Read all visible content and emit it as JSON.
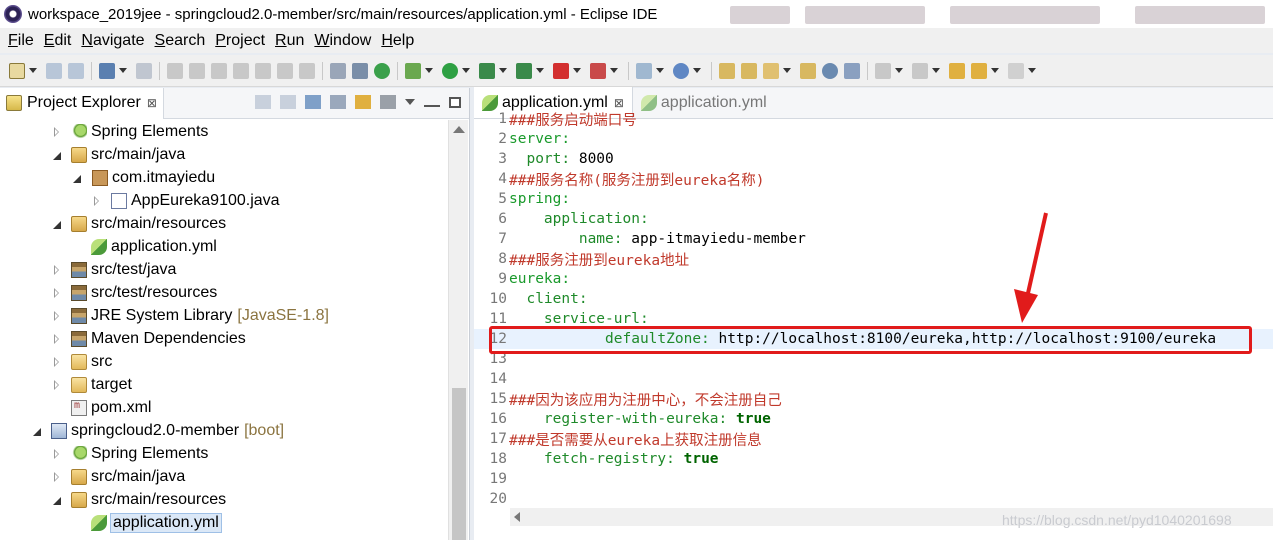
{
  "window": {
    "title": "workspace_2019jee - springcloud2.0-member/src/main/resources/application.yml - Eclipse IDE"
  },
  "menu": {
    "items": [
      {
        "label": "File",
        "key": "F",
        "rest": "ile"
      },
      {
        "label": "Edit",
        "key": "E",
        "rest": "dit"
      },
      {
        "label": "Navigate",
        "key": "N",
        "rest": "avigate"
      },
      {
        "label": "Search",
        "key": "S",
        "rest": "earch"
      },
      {
        "label": "Project",
        "key": "P",
        "rest": "roject"
      },
      {
        "label": "Run",
        "key": "R",
        "rest": "un"
      },
      {
        "label": "Window",
        "key": "W",
        "rest": "indow"
      },
      {
        "label": "Help",
        "key": "H",
        "rest": "elp"
      }
    ]
  },
  "explorer": {
    "tab_label": "Project Explorer",
    "close_glyph": "⊠",
    "tree": [
      {
        "label": "Spring Elements",
        "decoration": ""
      },
      {
        "label": "src/main/java",
        "decoration": ""
      },
      {
        "label": "com.itmayiedu",
        "decoration": ""
      },
      {
        "label": "AppEureka9100.java",
        "decoration": ""
      },
      {
        "label": "src/main/resources",
        "decoration": ""
      },
      {
        "label": "application.yml",
        "decoration": ""
      },
      {
        "label": "src/test/java",
        "decoration": ""
      },
      {
        "label": "src/test/resources",
        "decoration": ""
      },
      {
        "label": "JRE System Library",
        "decoration": "[JavaSE-1.8]"
      },
      {
        "label": "Maven Dependencies",
        "decoration": ""
      },
      {
        "label": "src",
        "decoration": ""
      },
      {
        "label": "target",
        "decoration": ""
      },
      {
        "label": "pom.xml",
        "decoration": ""
      },
      {
        "label": "springcloud2.0-member",
        "decoration": "[boot]"
      },
      {
        "label": "Spring Elements",
        "decoration": ""
      },
      {
        "label": "src/main/java",
        "decoration": ""
      },
      {
        "label": "src/main/resources",
        "decoration": ""
      },
      {
        "label": "application.yml",
        "decoration": ""
      }
    ]
  },
  "editor": {
    "active_tab": "application.yml",
    "inactive_tab": "application.yml",
    "close_glyph": "⊠",
    "lines": [
      {
        "n": "1",
        "text": "###服务启动端口号"
      },
      {
        "n": "2",
        "text": "server:"
      },
      {
        "n": "3",
        "key": "  port:",
        "val": " 8000"
      },
      {
        "n": "4",
        "text": "###服务名称(服务注册到eureka名称)"
      },
      {
        "n": "5",
        "text": "spring:"
      },
      {
        "n": "6",
        "text": "    application:"
      },
      {
        "n": "7",
        "key": "        name:",
        "val": " app-itmayiedu-member"
      },
      {
        "n": "8",
        "text": "###服务注册到eureka地址"
      },
      {
        "n": "9",
        "text": "eureka:"
      },
      {
        "n": "10",
        "text": "  client:"
      },
      {
        "n": "11",
        "text": "    service-url:"
      },
      {
        "n": "12",
        "key": "           defaultZone:",
        "val": " http://localhost:8100/eureka,http://localhost:9100/eureka"
      },
      {
        "n": "13",
        "text": ""
      },
      {
        "n": "14",
        "text": ""
      },
      {
        "n": "15",
        "text": "###因为该应用为注册中心，不会注册自己"
      },
      {
        "n": "16",
        "key": "    register-with-eureka:",
        "val": " true"
      },
      {
        "n": "17",
        "text": "###是否需要从eureka上获取注册信息"
      },
      {
        "n": "18",
        "key": "    fetch-registry:",
        "val": " true"
      },
      {
        "n": "19",
        "text": ""
      },
      {
        "n": "20",
        "text": ""
      }
    ]
  },
  "watermark": "https://blog.csdn.net/pyd1040201698",
  "colors": {
    "comment": "#c0392b",
    "yaml_key": "#1a9a2c",
    "highlight_box": "#e11b1b"
  }
}
